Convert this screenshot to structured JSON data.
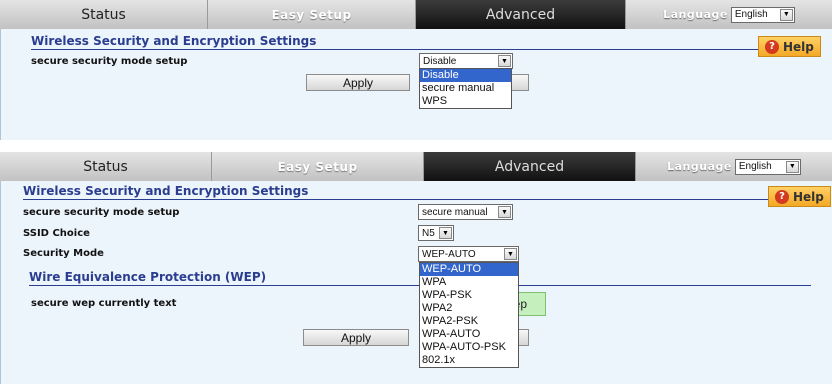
{
  "nav": {
    "status": "Status",
    "easy_setup": "Easy Setup",
    "advanced": "Advanced",
    "language_label": "Language",
    "language_value": "English"
  },
  "help_label": "Help",
  "top": {
    "title": "Wireless Security and Encryption Settings",
    "mode_label": "secure security mode setup",
    "mode_value": "Disable",
    "mode_options": [
      "Disable",
      "secure manual",
      "WPS"
    ],
    "apply": "Apply"
  },
  "bottom": {
    "title": "Wireless Security and Encryption Settings",
    "mode_label": "secure security mode setup",
    "mode_value": "secure manual",
    "ssid_label": "SSID Choice",
    "ssid_value": "N5",
    "security_label": "Security Mode",
    "security_value": "WEP-AUTO",
    "security_options": [
      "WEP-AUTO",
      "WPA",
      "WPA-PSK",
      "WPA2",
      "WPA2-PSK",
      "WPA-AUTO",
      "WPA-AUTO-PSK",
      "802.1x"
    ],
    "wep_title": "Wire Equivalence Protection (WEP)",
    "wep_text_label": "secure wep currently text",
    "wep_badge": "wep",
    "apply": "Apply"
  },
  "colors": {
    "title_blue": "#2b3d8f",
    "content_bg": "#edf5fc",
    "selected_option": "#3366cc",
    "help_orange": "#f4a825",
    "wep_green": "#c6efbe"
  },
  "icons": {
    "dropdown": "chevron-down-icon",
    "help": "question-icon"
  }
}
